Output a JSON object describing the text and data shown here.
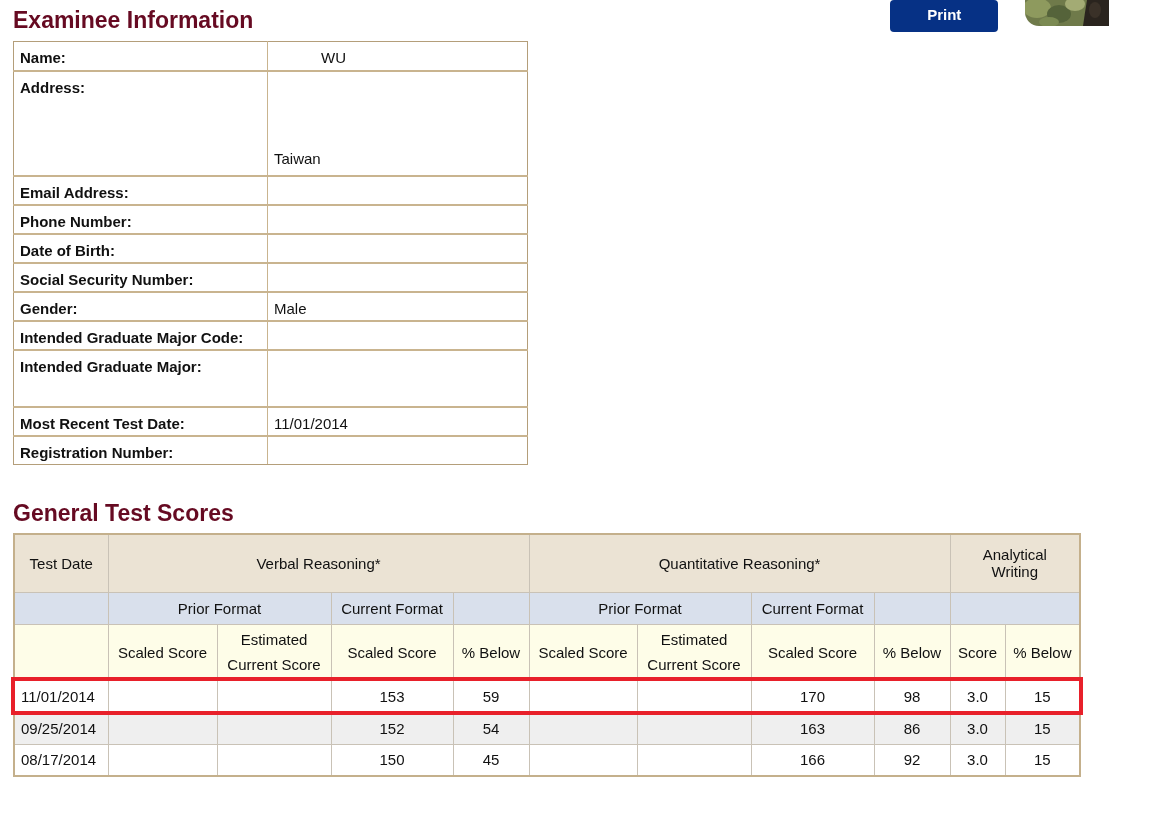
{
  "info": {
    "title": "Examinee Information",
    "rows": [
      {
        "label": "Name:",
        "value": "WU"
      },
      {
        "label": "Address:",
        "value": "Taiwan",
        "kind": "tall"
      },
      {
        "label": "Email Address:"
      },
      {
        "label": "Phone Number:"
      },
      {
        "label": "Date of Birth:"
      },
      {
        "label": "Social Security Number:"
      },
      {
        "label": "Gender:",
        "value": "Male"
      },
      {
        "label": "Intended Graduate Major Code:"
      },
      {
        "label": "Intended Graduate Major:",
        "kind": "medium"
      },
      {
        "label": "Most Recent Test Date:",
        "value": "11/01/2014"
      },
      {
        "label": "Registration Number:"
      }
    ]
  },
  "print_button": "Print",
  "scores": {
    "title": "General Test Scores",
    "top_headers": [
      "Test Date",
      "Verbal Reasoning*",
      "Quantitative Reasoning*",
      "Analytical Writing"
    ],
    "format_headers": [
      "Prior Format",
      "Current Format",
      "Prior Format",
      "Current Format"
    ],
    "columns": [
      "",
      "Scaled Score",
      "Estimated Current Score",
      "Scaled Score",
      "% Below",
      "Scaled Score",
      "Estimated Current Score",
      "Scaled Score",
      "% Below",
      "Score",
      "% Below"
    ],
    "rows": [
      {
        "highlighted": true,
        "cells": [
          "11/01/2014",
          null,
          null,
          "153",
          "59",
          null,
          null,
          "170",
          "98",
          "3.0",
          "15"
        ]
      },
      {
        "highlighted": false,
        "cells": [
          "09/25/2014",
          null,
          null,
          "152",
          "54",
          null,
          null,
          "163",
          "86",
          "3.0",
          "15"
        ]
      },
      {
        "highlighted": false,
        "cells": [
          "08/17/2014",
          null,
          null,
          "150",
          "45",
          null,
          null,
          "166",
          "92",
          "3.0",
          "15"
        ]
      }
    ]
  }
}
